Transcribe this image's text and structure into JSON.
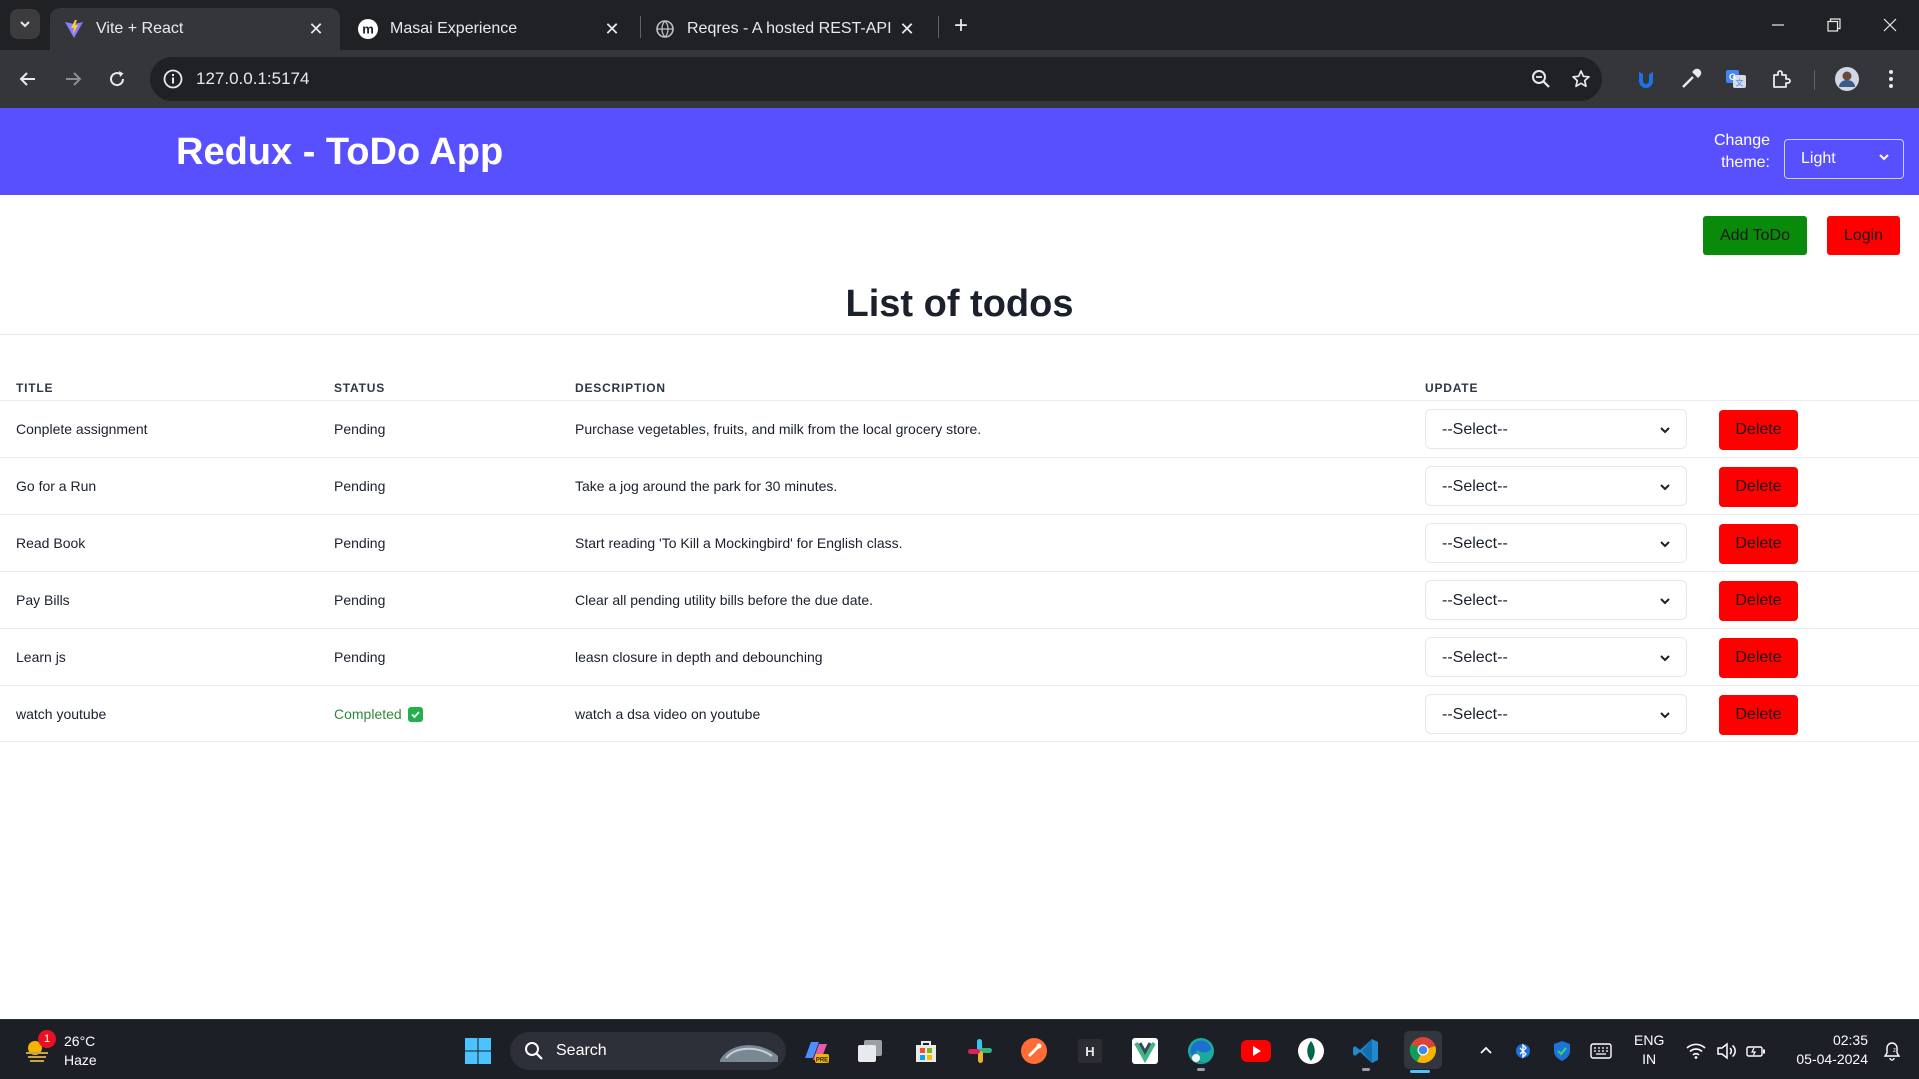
{
  "browser": {
    "tabs": [
      {
        "title": "Vite + React",
        "active": true
      },
      {
        "title": "Masai Experience",
        "active": false
      },
      {
        "title": "Reqres - A hosted REST-API rea",
        "active": false
      }
    ],
    "url": "127.0.0.1:5174"
  },
  "app": {
    "title": "Redux - ToDo App",
    "theme_label": "Change theme:",
    "theme_value": "Light",
    "add_button": "Add ToDo",
    "login_button": "Login",
    "list_heading": "List of todos",
    "columns": {
      "title": "TITLE",
      "status": "STATUS",
      "description": "DESCRIPTION",
      "update": "UPDATE"
    },
    "update_placeholder": "--Select--",
    "delete_label": "Delete",
    "todos": [
      {
        "title": "Conplete assignment",
        "status": "Pending",
        "description": "Purchase vegetables, fruits, and milk from the local grocery store."
      },
      {
        "title": "Go for a Run",
        "status": "Pending",
        "description": "Take a jog around the park for 30 minutes."
      },
      {
        "title": "Read Book",
        "status": "Pending",
        "description": "Start reading 'To Kill a Mockingbird' for English class."
      },
      {
        "title": "Pay Bills",
        "status": "Pending",
        "description": "Clear all pending utility bills before the due date."
      },
      {
        "title": "Learn js",
        "status": "Pending",
        "description": "leasn closure in depth and debounching"
      },
      {
        "title": "watch youtube",
        "status": "Completed",
        "description": "watch a dsa video on youtube"
      }
    ]
  },
  "taskbar": {
    "weather_temp": "26°C",
    "weather_condition": "Haze",
    "notification_count": "1",
    "search_label": "Search",
    "language_line1": "ENG",
    "language_line2": "IN",
    "time": "02:35",
    "date": "05-04-2024"
  },
  "colors": {
    "header_bg": "#5850ff",
    "add_button": "#0a8a0a",
    "login_button": "#ff0000",
    "delete_button": "#ff0000",
    "completed_text": "#2f8a3e"
  }
}
